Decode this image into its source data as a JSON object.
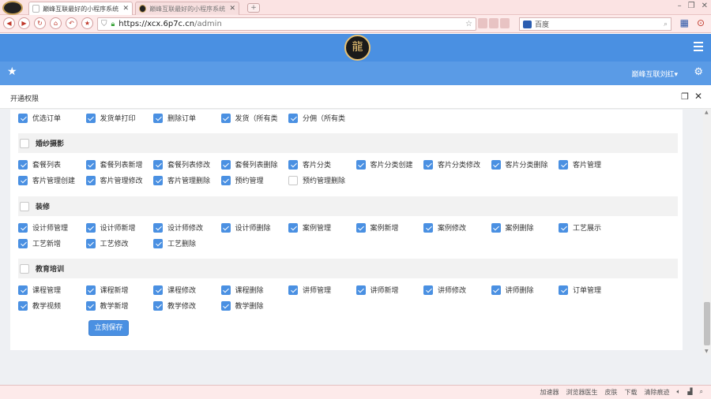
{
  "browser": {
    "tabs": [
      {
        "label": "巅峰互联最好的小程序系统"
      },
      {
        "label": "巅峰互联最好的小程序系统"
      }
    ],
    "new_tab": "+",
    "url_domain": "https://xcx.6p7c.cn",
    "url_path": "/admin",
    "search_engine": "百度",
    "status_items": [
      "加速器",
      "浏览器医生",
      "皮肤",
      "下载",
      "清除痕迹"
    ]
  },
  "app": {
    "user_label": "巅峰互联刘红▾",
    "modal_title": "开通权限",
    "save_label": "立刻保存"
  },
  "permissions": {
    "top_row": [
      {
        "label": "优选订单",
        "checked": true
      },
      {
        "label": "发货单打印",
        "checked": true
      },
      {
        "label": "删除订单",
        "checked": true
      },
      {
        "label": "发货（所有类",
        "checked": true
      },
      {
        "label": "分佣（所有类",
        "checked": true
      }
    ],
    "sections": [
      {
        "title": "婚纱摄影",
        "checked": false,
        "items": [
          {
            "label": "套餐列表",
            "checked": true
          },
          {
            "label": "套餐列表新增",
            "checked": true
          },
          {
            "label": "套餐列表修改",
            "checked": true
          },
          {
            "label": "套餐列表删除",
            "checked": true
          },
          {
            "label": "客片分类",
            "checked": true
          },
          {
            "label": "客片分类创建",
            "checked": true
          },
          {
            "label": "客片分类修改",
            "checked": true
          },
          {
            "label": "客片分类删除",
            "checked": true
          },
          {
            "label": "客片管理",
            "checked": true
          },
          {
            "label": "客片管理创建",
            "checked": true
          },
          {
            "label": "客片管理修改",
            "checked": true
          },
          {
            "label": "客片管理删除",
            "checked": true
          },
          {
            "label": "预约管理",
            "checked": true
          },
          {
            "label": "预约管理删除",
            "checked": false
          }
        ]
      },
      {
        "title": "装修",
        "checked": false,
        "items": [
          {
            "label": "设计师管理",
            "checked": true
          },
          {
            "label": "设计师新增",
            "checked": true
          },
          {
            "label": "设计师修改",
            "checked": true
          },
          {
            "label": "设计师删除",
            "checked": true
          },
          {
            "label": "案例管理",
            "checked": true
          },
          {
            "label": "案例新增",
            "checked": true
          },
          {
            "label": "案例修改",
            "checked": true
          },
          {
            "label": "案例删除",
            "checked": true
          },
          {
            "label": "工艺展示",
            "checked": true
          },
          {
            "label": "工艺新增",
            "checked": true
          },
          {
            "label": "工艺修改",
            "checked": true
          },
          {
            "label": "工艺删除",
            "checked": true
          }
        ]
      },
      {
        "title": "教育培训",
        "checked": false,
        "items": [
          {
            "label": "课程管理",
            "checked": true
          },
          {
            "label": "课程新增",
            "checked": true
          },
          {
            "label": "课程修改",
            "checked": true
          },
          {
            "label": "课程删除",
            "checked": true
          },
          {
            "label": "讲师管理",
            "checked": true
          },
          {
            "label": "讲师新增",
            "checked": true
          },
          {
            "label": "讲师修改",
            "checked": true
          },
          {
            "label": "讲师删除",
            "checked": true
          },
          {
            "label": "订单管理",
            "checked": true
          },
          {
            "label": "教学视频",
            "checked": true
          },
          {
            "label": "教学新增",
            "checked": true
          },
          {
            "label": "教学修改",
            "checked": true
          },
          {
            "label": "教学删除",
            "checked": true
          }
        ]
      }
    ]
  }
}
